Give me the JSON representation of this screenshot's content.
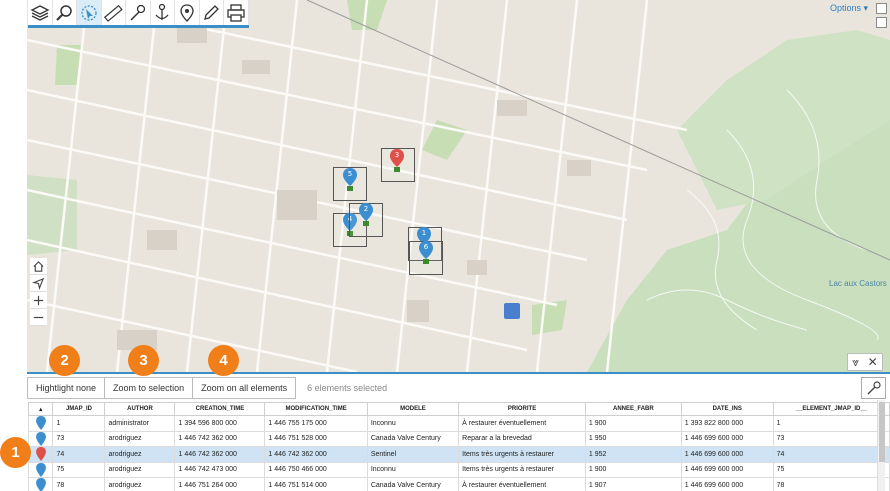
{
  "toolbar": {
    "tools": [
      {
        "name": "layers-icon",
        "active": false
      },
      {
        "name": "search-icon",
        "active": false
      },
      {
        "name": "select-icon",
        "active": true
      },
      {
        "name": "measure-icon",
        "active": false
      },
      {
        "name": "pick-icon",
        "active": false
      },
      {
        "name": "anchor-icon",
        "active": false
      },
      {
        "name": "location-icon",
        "active": false
      },
      {
        "name": "edit-icon",
        "active": false
      },
      {
        "name": "print-icon",
        "active": false
      }
    ]
  },
  "map": {
    "options_label": "Options ▾",
    "lake_label": "Lac aux Castors",
    "markers": [
      {
        "label": "5",
        "color": "#3b8fd0"
      },
      {
        "label": "3",
        "color": "#e0504a"
      },
      {
        "label": "4",
        "color": "#3b8fd0"
      },
      {
        "label": "2",
        "color": "#3b8fd0"
      },
      {
        "label": "1",
        "color": "#3b8fd0"
      },
      {
        "label": "6",
        "color": "#3b8fd0"
      }
    ]
  },
  "callouts": [
    "1",
    "2",
    "3",
    "4"
  ],
  "panel": {
    "highlight_none": "Hightlight none",
    "zoom_selection": "Zoom to selection",
    "zoom_all": "Zoom on all elements",
    "selected_count": "6 elements selected",
    "columns": [
      "JMAP_ID",
      "AUTHOR",
      "CREATION_TIME",
      "MODIFICATION_TIME",
      "MODELE",
      "PRIORITE",
      "ANNEE_FABR",
      "DATE_INS",
      "__ELEMENT_JMAP_ID__"
    ],
    "rows": [
      {
        "cells": [
          "1",
          "administrator",
          "1 394 596 800 000",
          "1 446 755 175 000",
          "Inconnu",
          "À restaurer éventuellement",
          "1 900",
          "1 393 822 800 000",
          "1"
        ],
        "pin": "#3b8fd0",
        "selected": false
      },
      {
        "cells": [
          "73",
          "arodriguez",
          "1 446 742 362 000",
          "1 446 751 528 000",
          "Canada Valve Century",
          "Reparar a la brevedad",
          "1 950",
          "1 446 699 600 000",
          "73"
        ],
        "pin": "#3b8fd0",
        "selected": false
      },
      {
        "cells": [
          "74",
          "arodriguez",
          "1 446 742 362 000",
          "1 446 742 362 000",
          "Sentinel",
          "Items très urgents à restaurer",
          "1 952",
          "1 446 699 600 000",
          "74"
        ],
        "pin": "#e0504a",
        "selected": true
      },
      {
        "cells": [
          "75",
          "arodriguez",
          "1 446 742 473 000",
          "1 446 750 466 000",
          "Inconnu",
          "Items très urgents à restaurer",
          "1 900",
          "1 446 699 600 000",
          "75"
        ],
        "pin": "#3b8fd0",
        "selected": false
      },
      {
        "cells": [
          "78",
          "arodriguez",
          "1 446 751 264 000",
          "1 446 751 514 000",
          "Canada Valve Century",
          "À restaurer éventuellement",
          "1 907",
          "1 446 699 600 000",
          "78"
        ],
        "pin": "#3b8fd0",
        "selected": false
      }
    ]
  }
}
